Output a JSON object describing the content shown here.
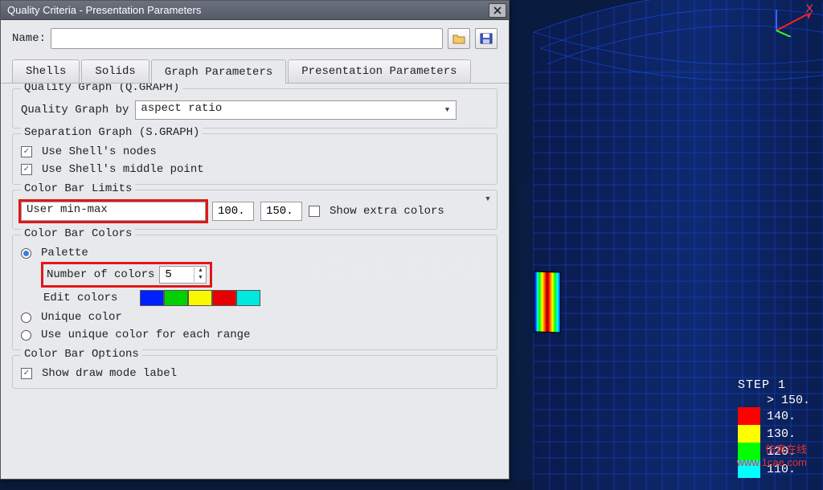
{
  "dialog": {
    "title": "Quality Criteria - Presentation Parameters",
    "name_label": "Name:",
    "name_value": "",
    "tabs": [
      "Shells",
      "Solids",
      "Graph Parameters",
      "Presentation Parameters"
    ],
    "active_tab": 2
  },
  "qgraph": {
    "title": "Quality Graph (Q.GRAPH)",
    "by_label": "Quality Graph by",
    "by_value": "aspect ratio"
  },
  "sgraph": {
    "title": "Separation Graph (S.GRAPH)",
    "opt1": "Use Shell's nodes",
    "opt2": "Use Shell's middle point"
  },
  "limits": {
    "title": "Color Bar Limits",
    "mode": "User min-max",
    "min": "100.",
    "max": "150.",
    "extra_label": "Show extra colors"
  },
  "colors": {
    "title": "Color Bar Colors",
    "palette_label": "Palette",
    "num_label": "Number of colors",
    "num_value": "5",
    "edit_label": "Edit colors",
    "swatches": [
      "#0020ff",
      "#00d000",
      "#f8f800",
      "#e80000",
      "#00e8e0"
    ],
    "unique_label": "Unique color",
    "range_label": "Use unique color for each range"
  },
  "options": {
    "title": "Color Bar Options",
    "draw_mode": "Show draw mode label"
  },
  "legend": {
    "title": "STEP 1",
    "gt": "> 150.",
    "rows": [
      {
        "color": "#ff0000",
        "label": "140."
      },
      {
        "color": "#ffff00",
        "label": "130."
      },
      {
        "color": "#00ff00",
        "label": "120."
      },
      {
        "color": "#00ffff",
        "label": "110."
      }
    ]
  },
  "watermarks": {
    "wm1": "www.1cae.com",
    "wm2": "1CAE.COM",
    "wm3": "仿真在线"
  },
  "axis": {
    "x": "X"
  }
}
